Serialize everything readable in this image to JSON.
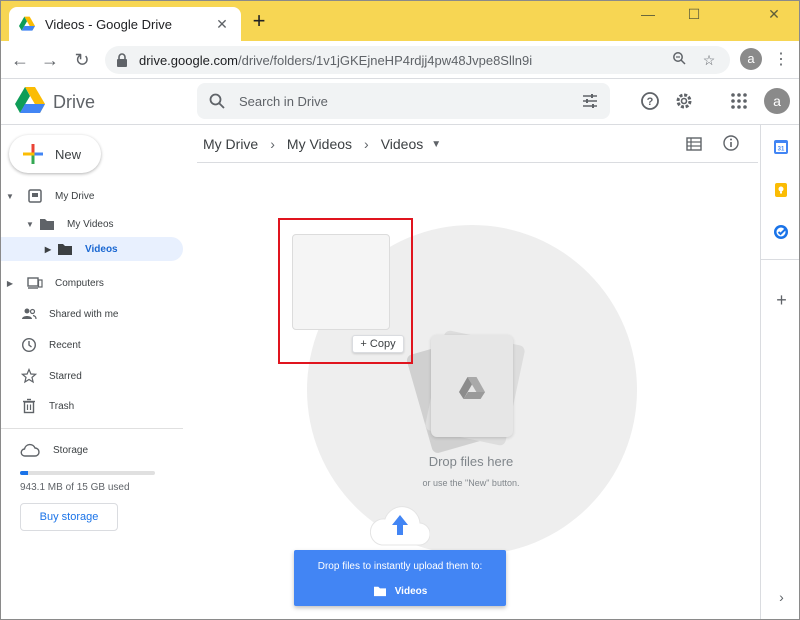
{
  "browser": {
    "tab_title": "Videos - Google Drive",
    "tab_close": "✕",
    "new_tab": "+",
    "url_host": "drive.google.com",
    "url_path": "/drive/folders/1v1jGKEjneHP4rdjj4pw48Jvpe8Slln9i",
    "avatar_letter": "a"
  },
  "drive": {
    "brand": "Drive",
    "search_placeholder": "Search in Drive",
    "avatar_letter": "a"
  },
  "sidebar": {
    "new_label": "New",
    "items": [
      {
        "label": "My Drive"
      },
      {
        "label": "My Videos"
      },
      {
        "label": "Videos"
      },
      {
        "label": "Computers"
      },
      {
        "label": "Shared with me"
      },
      {
        "label": "Recent"
      },
      {
        "label": "Starred"
      },
      {
        "label": "Trash"
      }
    ],
    "storage_label": "Storage",
    "storage_used": "943.1 MB of 15 GB used",
    "storage_fraction": 0.06,
    "buy_storage": "Buy storage"
  },
  "breadcrumb": [
    "My Drive",
    "My Videos",
    "Videos"
  ],
  "main": {
    "drop_title": "Drop files here",
    "drop_sub": "or use the \"New\" button.",
    "copy_label": "Copy"
  },
  "toast": {
    "line1": "Drop files to instantly upload them to:",
    "folder": "Videos"
  },
  "colors": {
    "titlebar": "#f7d653",
    "accent": "#1a73e8",
    "toast": "#4285f4",
    "highlight_box": "#e0141e"
  }
}
